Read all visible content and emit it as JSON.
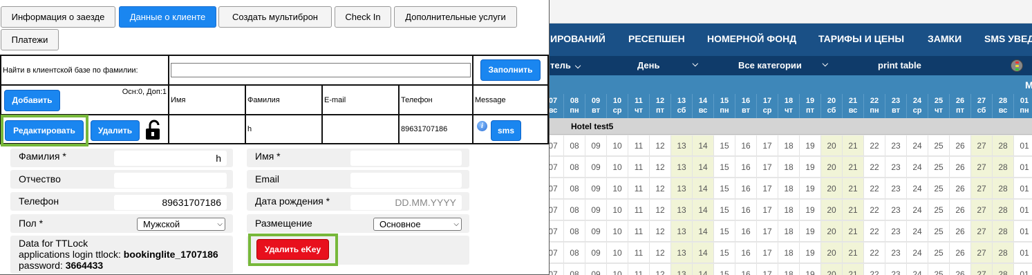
{
  "background": {
    "nav": [
      "ИРОВАНИЙ",
      "РЕСЕПШЕН",
      "НОМЕРНОЙ ФОНД",
      "ТАРИФЫ И ЦЕНЫ",
      "ЗАМКИ",
      "SMS УВЕД"
    ],
    "filters": {
      "hotel": "тель",
      "period": "День",
      "category": "Все категории",
      "print": "print table"
    },
    "month_next": "М",
    "dates": [
      {
        "d": "07",
        "w": "вс"
      },
      {
        "d": "08",
        "w": "пн"
      },
      {
        "d": "09",
        "w": "вт"
      },
      {
        "d": "10",
        "w": "ср"
      },
      {
        "d": "11",
        "w": "чт"
      },
      {
        "d": "12",
        "w": "пт"
      },
      {
        "d": "13",
        "w": "сб"
      },
      {
        "d": "14",
        "w": "вс"
      },
      {
        "d": "15",
        "w": "пн"
      },
      {
        "d": "16",
        "w": "вт"
      },
      {
        "d": "17",
        "w": "ср"
      },
      {
        "d": "18",
        "w": "чт"
      },
      {
        "d": "19",
        "w": "пт"
      },
      {
        "d": "20",
        "w": "сб"
      },
      {
        "d": "21",
        "w": "вс"
      },
      {
        "d": "22",
        "w": "пн"
      },
      {
        "d": "23",
        "w": "вт"
      },
      {
        "d": "24",
        "w": "ср"
      },
      {
        "d": "25",
        "w": "чт"
      },
      {
        "d": "26",
        "w": "пт"
      },
      {
        "d": "27",
        "w": "сб"
      },
      {
        "d": "28",
        "w": "вс"
      },
      {
        "d": "01",
        "w": "пн"
      }
    ],
    "hotel_name": "Hotel test5",
    "weekend_columns": [
      "13",
      "14",
      "20",
      "21",
      "27",
      "28"
    ]
  },
  "modal": {
    "tabs": [
      "Информация о заезде",
      "Данные о клиенте",
      "Создать мультиброн",
      "Check In",
      "Дополнительные услуги",
      "Платежи"
    ],
    "active_tab": "Данные о клиенте",
    "search": {
      "label": "Найти в клиентской базе по фамилии:",
      "value": "",
      "fill_button": "Заполнить"
    },
    "client_table": {
      "add_button": "Добавить",
      "counts": "Осн:0, Доп:1",
      "headers": [
        "Имя",
        "Фамилия",
        "E-mail",
        "Телефон",
        "Message"
      ],
      "edit_button": "Редактировать",
      "delete_button": "Удалить",
      "row": {
        "name": "",
        "surname": "h",
        "email": "",
        "phone": "89631707186"
      },
      "sms_button": "sms"
    },
    "form": {
      "surname_label": "Фамилия *",
      "surname_value": "h",
      "name_label": "Имя *",
      "name_value": "",
      "patronymic_label": "Отчество",
      "patronymic_value": "",
      "email_label": "Email",
      "email_value": "",
      "phone_label": "Телефон",
      "phone_value": "89631707186",
      "birth_label": "Дата рождения *",
      "birth_placeholder": "DD.MM.YYYY",
      "gender_label": "Пол *",
      "gender_value": "Мужской",
      "placement_label": "Размещение",
      "placement_value": "Основное"
    },
    "ttlock": {
      "line1": "Data for TTLock",
      "login_label": "applications login ttlock: ",
      "login_value": "bookinglite_1707186",
      "password_label": "password: ",
      "password_value": "3664433"
    },
    "delete_ekey_button": "Удалить eKey",
    "colors": {
      "primary": "#1a86f0",
      "danger": "#e8101d",
      "highlight": "#77b83a",
      "nav": "#1a5086",
      "date_header": "#3e87b9"
    }
  }
}
